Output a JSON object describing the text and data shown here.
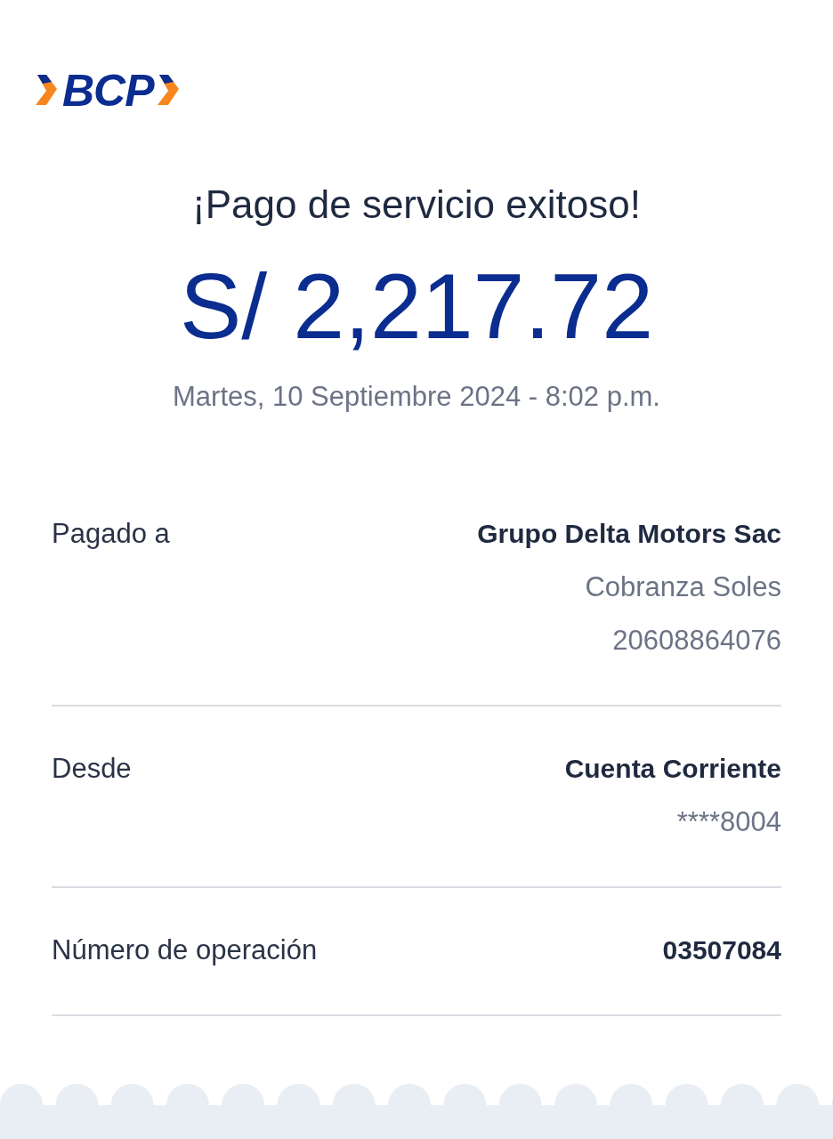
{
  "logo": {
    "text": "BCP"
  },
  "title": "¡Pago de servicio exitoso!",
  "amount": "S/ 2,217.72",
  "datetime": "Martes, 10 Septiembre 2024 - 8:02 p.m.",
  "details": [
    {
      "label": "Pagado a",
      "values": [
        "Grupo Delta Motors Sac",
        "Cobranza Soles",
        "20608864076"
      ]
    },
    {
      "label": "Desde",
      "values": [
        "Cuenta Corriente",
        "****8004"
      ]
    },
    {
      "label": "Número de operación",
      "values": [
        "03507084"
      ]
    }
  ]
}
